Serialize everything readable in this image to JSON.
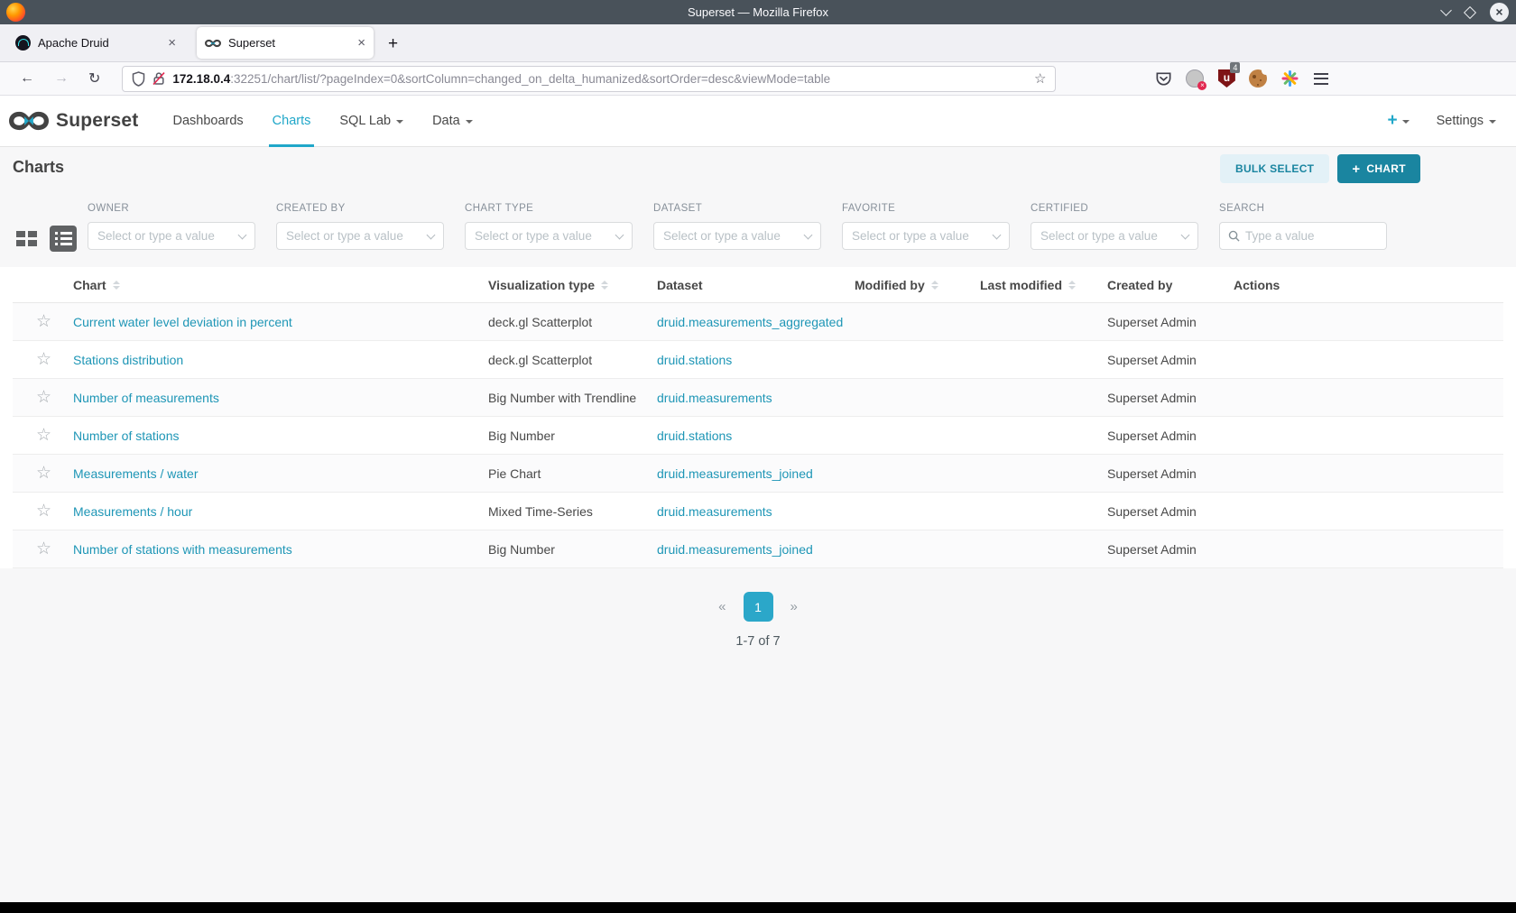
{
  "titlebar": {
    "title": "Superset — Mozilla Firefox"
  },
  "tabs": {
    "druid_label": "Apache Druid",
    "superset_label": "Superset",
    "close": "×",
    "new_tab": "+"
  },
  "toolbar": {
    "back": "←",
    "forward": "→",
    "reload": "↻",
    "url_host": "172.18.0.4",
    "url_rest": ":32251/chart/list/?pageIndex=0&sortColumn=changed_on_delta_humanized&sortOrder=desc&viewMode=table",
    "bookmark_star": "☆",
    "ublock_letter": "u",
    "ublock_badge": "4"
  },
  "navbar": {
    "brand": "Superset",
    "dashboards": "Dashboards",
    "charts": "Charts",
    "sql_lab": "SQL Lab",
    "data": "Data",
    "plus": "+",
    "settings": "Settings"
  },
  "page": {
    "title": "Charts",
    "bulk_select": "BULK SELECT",
    "new_chart_plus": "+",
    "new_chart": "CHART"
  },
  "filters": [
    {
      "label": "OWNER",
      "placeholder": "Select or type a value"
    },
    {
      "label": "CREATED BY",
      "placeholder": "Select or type a value"
    },
    {
      "label": "CHART TYPE",
      "placeholder": "Select or type a value"
    },
    {
      "label": "DATASET",
      "placeholder": "Select or type a value"
    },
    {
      "label": "FAVORITE",
      "placeholder": "Select or type a value"
    },
    {
      "label": "CERTIFIED",
      "placeholder": "Select or type a value"
    },
    {
      "label": "SEARCH",
      "placeholder": "Type a value"
    }
  ],
  "table": {
    "columns": [
      "Chart",
      "Visualization type",
      "Dataset",
      "Modified by",
      "Last modified",
      "Created by",
      "Actions"
    ],
    "favorite_star": "☆",
    "rows": [
      {
        "name": "Current water level deviation in percent",
        "viz_type": "deck.gl Scatterplot",
        "dataset": "druid.measurements_aggregated",
        "modified_by": "",
        "last_modified": "",
        "created_by": "Superset Admin"
      },
      {
        "name": "Stations distribution",
        "viz_type": "deck.gl Scatterplot",
        "dataset": "druid.stations",
        "modified_by": "",
        "last_modified": "",
        "created_by": "Superset Admin"
      },
      {
        "name": "Number of measurements",
        "viz_type": "Big Number with Trendline",
        "dataset": "druid.measurements",
        "modified_by": "",
        "last_modified": "",
        "created_by": "Superset Admin"
      },
      {
        "name": "Number of stations",
        "viz_type": "Big Number",
        "dataset": "druid.stations",
        "modified_by": "",
        "last_modified": "",
        "created_by": "Superset Admin"
      },
      {
        "name": "Measurements / water",
        "viz_type": "Pie Chart",
        "dataset": "druid.measurements_joined",
        "modified_by": "",
        "last_modified": "",
        "created_by": "Superset Admin"
      },
      {
        "name": "Measurements / hour",
        "viz_type": "Mixed Time-Series",
        "dataset": "druid.measurements",
        "modified_by": "",
        "last_modified": "",
        "created_by": "Superset Admin"
      },
      {
        "name": "Number of stations with measurements",
        "viz_type": "Big Number",
        "dataset": "druid.measurements_joined",
        "modified_by": "",
        "last_modified": "",
        "created_by": "Superset Admin"
      }
    ]
  },
  "pagination": {
    "prev": "«",
    "page": "1",
    "next": "»",
    "summary": "1-7 of 7"
  },
  "colors": {
    "accent": "#20a7c9",
    "button": "#1a85a0",
    "link": "#1e96b6",
    "titlebar": "#49525a"
  }
}
